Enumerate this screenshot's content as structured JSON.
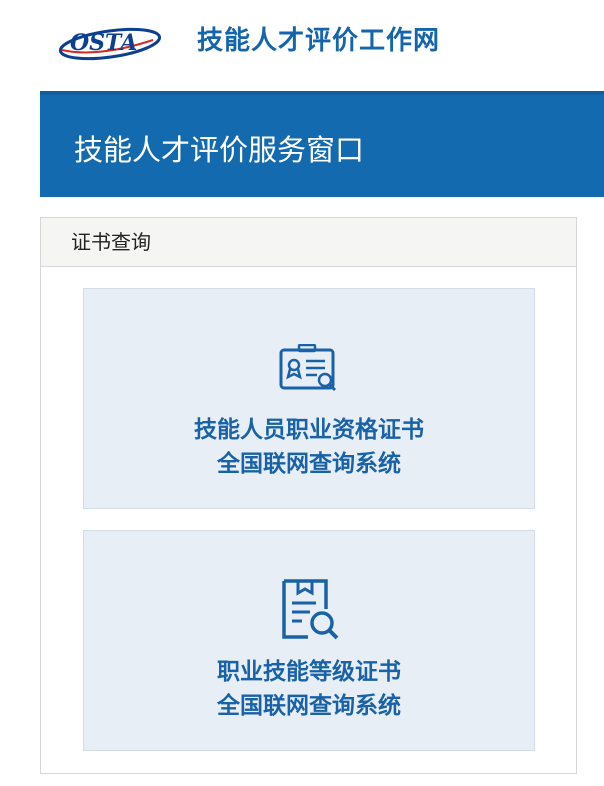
{
  "header": {
    "logo_text": "OSTA",
    "site_title": "技能人才评价工作网"
  },
  "banner": {
    "title": "技能人才评价服务窗口"
  },
  "panel": {
    "title": "证书查询",
    "cards": [
      {
        "icon": "certificate-search-icon",
        "line1": "技能人员职业资格证书",
        "line2": "全国联网查询系统"
      },
      {
        "icon": "document-search-icon",
        "line1": "职业技能等级证书",
        "line2": "全国联网查询系统"
      }
    ]
  },
  "colors": {
    "brand_blue": "#146aae",
    "card_bg": "#e7eef5",
    "card_text": "#1a62a8"
  }
}
